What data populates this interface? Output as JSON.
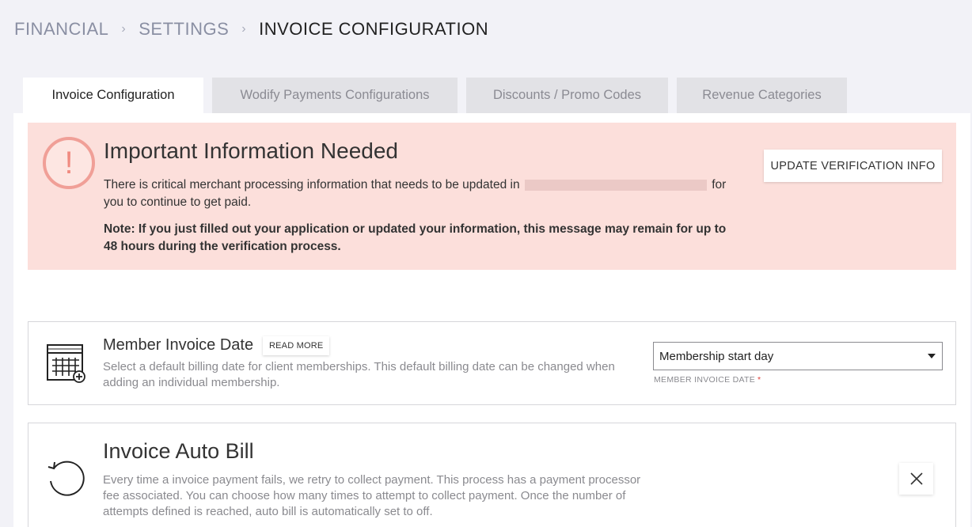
{
  "breadcrumb": {
    "items": [
      "FINANCIAL",
      "SETTINGS",
      "INVOICE CONFIGURATION"
    ]
  },
  "tabs": [
    {
      "label": "Invoice Configuration",
      "active": true
    },
    {
      "label": "Wodify Payments Configurations",
      "active": false
    },
    {
      "label": "Discounts / Promo Codes",
      "active": false
    },
    {
      "label": "Revenue Categories",
      "active": false
    }
  ],
  "alert": {
    "icon": "exclamation-circle-icon",
    "title": "Important Information Needed",
    "text_before": "There is critical merchant processing information that needs to be updated in",
    "text_after": "for you to continue to get paid.",
    "note": "Note: If you just filled out your application or updated your information, this message may remain for up to 48 hours during the verification process.",
    "button_label": "UPDATE VERIFICATION INFO",
    "bg_color": "#fcdfdb",
    "icon_color": "#f09f97"
  },
  "member_invoice_date": {
    "icon": "calendar-add-icon",
    "title": "Member Invoice Date",
    "read_more_label": "READ MORE",
    "description": "Select a default billing date for client memberships. This default billing date can be changed when adding an individual membership.",
    "select_value": "Membership start day",
    "select_label": "MEMBER INVOICE DATE",
    "required_mark": "*"
  },
  "auto_bill": {
    "icon": "retry-icon",
    "title": "Invoice Auto Bill",
    "description": "Every time a invoice payment fails, we retry to collect payment. This process has a payment processor fee associated. You can choose how many times to attempt to collect payment. Once the number of attempts defined is reached, auto bill is automatically set to off.",
    "close_icon": "close-icon"
  }
}
